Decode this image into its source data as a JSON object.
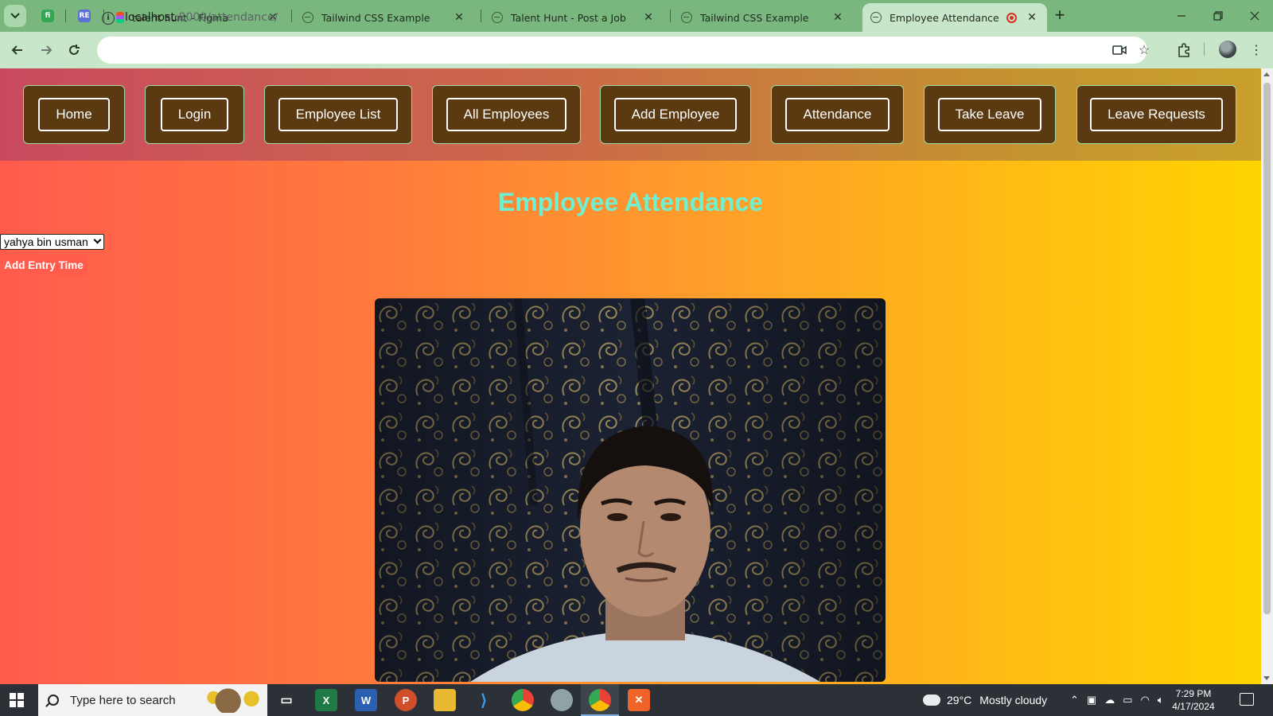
{
  "browser": {
    "tabs": [
      {
        "title": "talent hunt – Figma",
        "active": false
      },
      {
        "title": "Tailwind CSS Example",
        "active": false
      },
      {
        "title": "Talent Hunt - Post a Job",
        "active": false
      },
      {
        "title": "Tailwind CSS Example",
        "active": false
      },
      {
        "title": "Employee Attendance",
        "active": true
      }
    ],
    "url_host": "localhost",
    "url_path": ":8000/attendance/"
  },
  "nav": {
    "links": [
      "Home",
      "Login",
      "Employee List",
      "All Employees",
      "Add Employee",
      "Attendance",
      "Take Leave",
      "Leave Requests"
    ]
  },
  "page": {
    "title": "Employee Attendance",
    "employee_select_value": "yahya bin usman",
    "add_entry_label": "Add Entry Time"
  },
  "taskbar": {
    "search_placeholder": "Type here to search",
    "weather_temp": "29°C",
    "weather_text": "Mostly cloudy",
    "time": "7:29 PM",
    "date": "4/17/2024"
  },
  "colors": {
    "accent_title": "#6ff0d2",
    "nav_card": "#5b3a12",
    "button_red": "#ff5c4d"
  }
}
